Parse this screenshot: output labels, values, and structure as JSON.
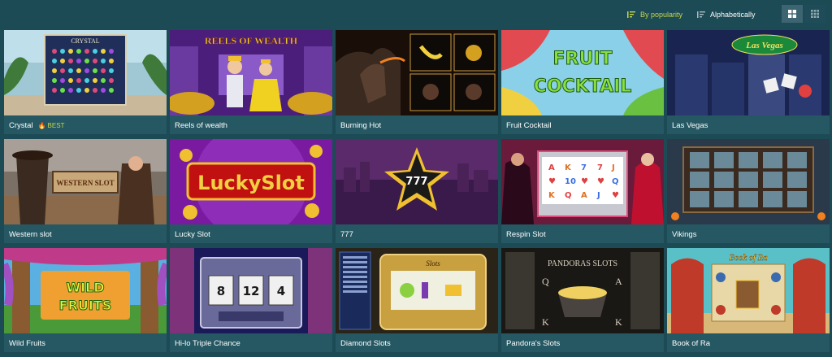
{
  "toolbar": {
    "sort_popularity": "By popularity",
    "sort_alphabetical": "Alphabetically",
    "active_sort": "popularity",
    "active_view": "grid-large",
    "accent_color": "#c9d64a"
  },
  "games": [
    {
      "title": "Crystal",
      "badge": "BEST",
      "thumb_text": "CRYSTAL"
    },
    {
      "title": "Reels of wealth",
      "thumb_text": "REELS OF WEALTH"
    },
    {
      "title": "Burning Hot"
    },
    {
      "title": "Fruit Cocktail",
      "thumb_text_1": "FRUIT",
      "thumb_text_2": "COCKTAIL"
    },
    {
      "title": "Las Vegas",
      "thumb_text": "Las Vegas"
    },
    {
      "title": "Western slot",
      "thumb_text": "WESTERN SLOT"
    },
    {
      "title": "Lucky Slot",
      "thumb_text": "LuckySlot"
    },
    {
      "title": "777",
      "thumb_text": "777"
    },
    {
      "title": "Respin Slot"
    },
    {
      "title": "Vikings"
    },
    {
      "title": "Wild Fruits",
      "thumb_text_1": "WILD",
      "thumb_text_2": "FRUITS"
    },
    {
      "title": "Hi-lo Triple Chance",
      "thumb_reels": [
        "8",
        "12",
        "4"
      ]
    },
    {
      "title": "Diamond Slots",
      "thumb_text": "Slots"
    },
    {
      "title": "Pandora's Slots",
      "thumb_text": "PANDORAS SLOTS"
    },
    {
      "title": "Book of Ra",
      "thumb_text": "Book of Ra"
    }
  ]
}
